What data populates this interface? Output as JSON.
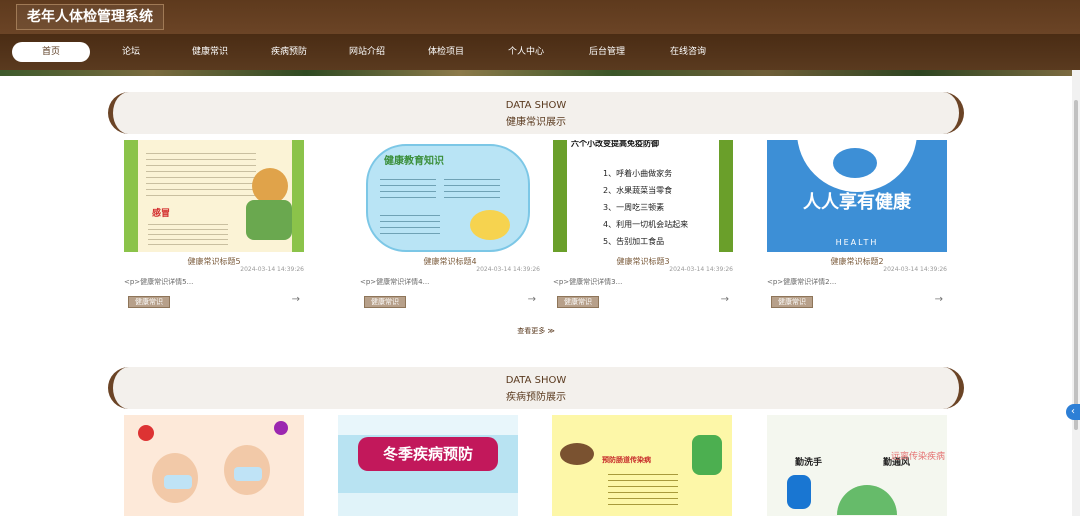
{
  "app": {
    "title": "老年人体检管理系统"
  },
  "nav": {
    "items": [
      {
        "label": "首页",
        "active": true
      },
      {
        "label": "论坛"
      },
      {
        "label": "健康常识"
      },
      {
        "label": "疾病预防"
      },
      {
        "label": "网站介绍"
      },
      {
        "label": "体检项目"
      },
      {
        "label": "个人中心"
      },
      {
        "label": "后台管理"
      },
      {
        "label": "在线咨询"
      }
    ]
  },
  "health": {
    "en": "DATA SHOW",
    "cn": "健康常识展示",
    "more": "查看更多 ≫",
    "cards": [
      {
        "title": "健康常识标题5",
        "date": "2024-03-14 14:39:26",
        "desc": "<p>健康常识详情5...",
        "tag": "健康常识",
        "image_text": "感冒"
      },
      {
        "title": "健康常识标题4",
        "date": "2024-03-14 14:39:26",
        "desc": "<p>健康常识详情4...",
        "tag": "健康常识",
        "image_text": "健康教育知识"
      },
      {
        "title": "健康常识标题3",
        "date": "2024-03-14 14:39:26",
        "desc": "<p>健康常识详情3...",
        "tag": "健康常识",
        "image_text": "六个小改变提高免疫防御",
        "image_list": [
          "1、呼着小曲做家务",
          "2、水果蔬菜当零食",
          "3、一周吃三顿素",
          "4、利用一切机会站起来",
          "5、告别加工食品"
        ]
      },
      {
        "title": "健康常识标题2",
        "date": "2024-03-14 14:39:26",
        "desc": "<p>健康常识详情2...",
        "tag": "健康常识",
        "image_text": "人人享有健康",
        "image_sub": "HEALTH"
      }
    ]
  },
  "disease": {
    "en": "DATA SHOW",
    "cn": "疾病预防展示",
    "cards": [
      {
        "image_text": ""
      },
      {
        "image_text": "冬季疾病预防"
      },
      {
        "image_text": "预防肠道传染病"
      },
      {
        "image_text": "勤洗手",
        "image_text2": "勤通风",
        "image_text3": "远离传染疾病"
      }
    ]
  },
  "colors": {
    "brand": "#5e3a1d",
    "accent": "#6b4426",
    "tag": "#b7a08a"
  }
}
